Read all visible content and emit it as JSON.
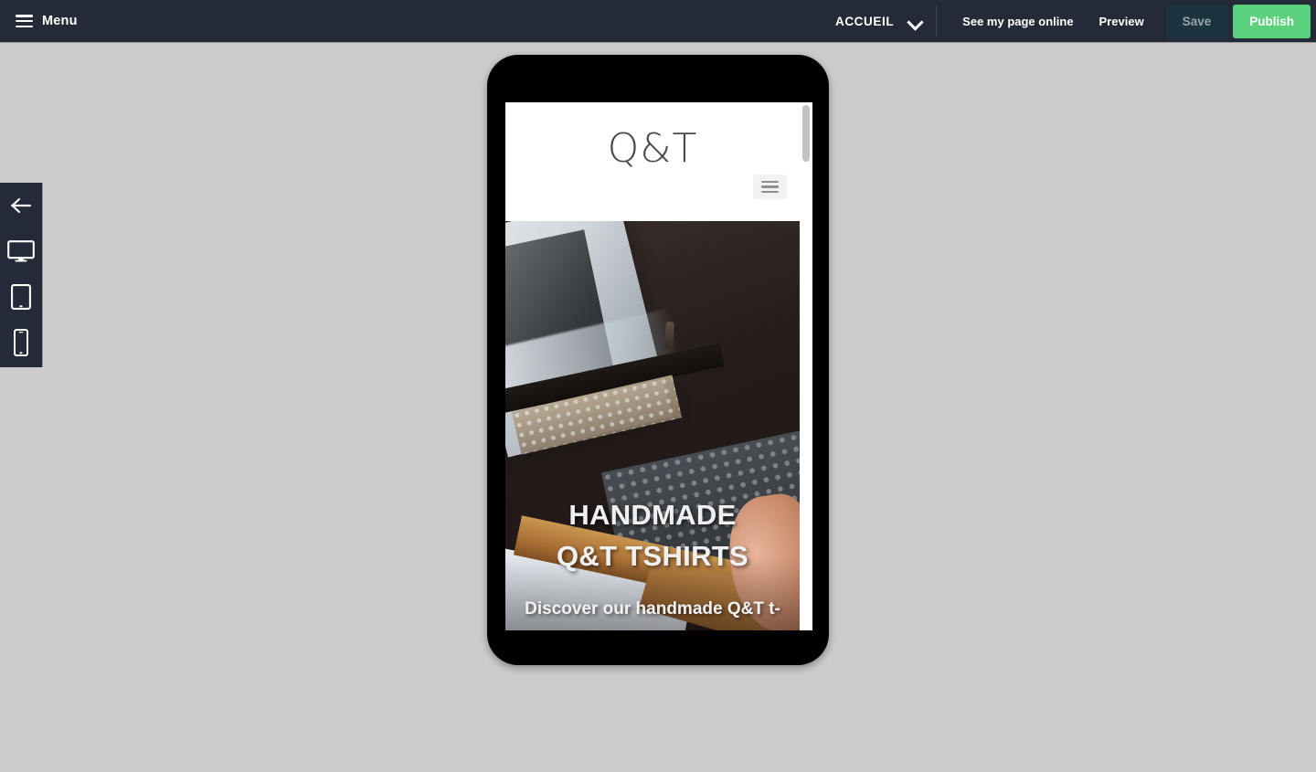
{
  "topbar": {
    "menu_label": "Menu",
    "menu_icon": "hamburger-icon",
    "page_selector": {
      "current_page": "ACCUEIL",
      "chevron_icon": "chevron-down-icon"
    },
    "links": [
      {
        "label": "See my page online"
      },
      {
        "label": "Preview"
      }
    ],
    "save_label": "Save",
    "publish_label": "Publish",
    "colors": {
      "background": "#252a38",
      "save_bg": "#1b3440",
      "save_text": "#9aa4ab",
      "publish_bg": "#5cd17c",
      "publish_text": "#ffffff",
      "text": "#ffffff"
    }
  },
  "sidebar": {
    "items": [
      {
        "name": "back-arrow-icon",
        "label": "Back"
      },
      {
        "name": "desktop-icon",
        "label": "Desktop view"
      },
      {
        "name": "tablet-icon",
        "label": "Tablet view"
      },
      {
        "name": "mobile-icon",
        "label": "Mobile view"
      }
    ],
    "active_item": "mobile-icon",
    "background": "#252a38"
  },
  "canvas": {
    "background": "#cccccc",
    "device": "mobile"
  },
  "preview": {
    "site": {
      "logo": "Q&T",
      "nav_toggle_icon": "hamburger-icon",
      "hero": {
        "title_line_1": "HANDMADE",
        "title_line_2": "Q&T TSHIRTS",
        "subtitle": "Discover our handmade Q&T t-",
        "image_description": "Screen printing frame on a table by a window"
      },
      "scrollbar": {
        "name": "page-scrollbar",
        "thumb_position": "top"
      }
    }
  }
}
